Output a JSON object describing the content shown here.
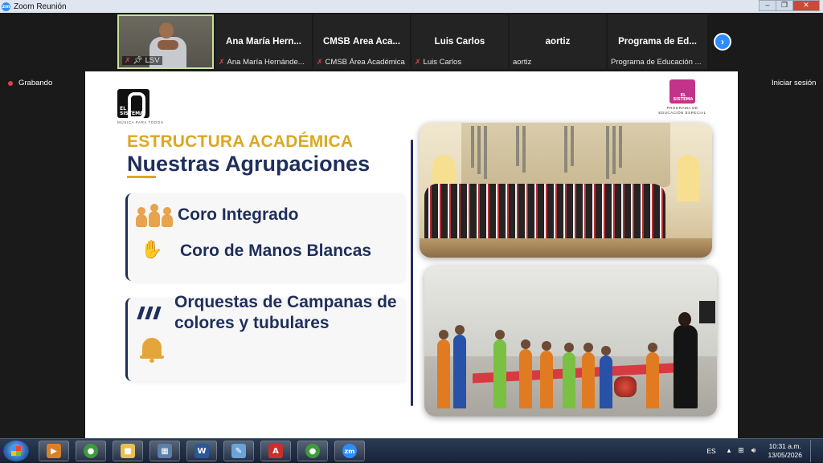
{
  "window": {
    "app_icon": "zm",
    "title": "Zoom Reunión",
    "controls": [
      "minimize",
      "restore",
      "close"
    ]
  },
  "gallery": {
    "tiles": [
      {
        "big_name": "",
        "label": "LSV",
        "video": true,
        "muted": true
      },
      {
        "big_name": "Ana María Hern...",
        "label": "Ana María Hernánde...",
        "video": false,
        "muted": true
      },
      {
        "big_name": "CMSB Área Aca...",
        "label": "CMSB Área Académica",
        "video": false,
        "muted": true
      },
      {
        "big_name": "Luis Carlos",
        "label": "Luis Carlos",
        "video": false,
        "muted": true
      },
      {
        "big_name": "aortiz",
        "label": "aortiz",
        "video": false,
        "muted": false
      },
      {
        "big_name": "Programa de Ed...",
        "label": "Programa de Educación ...",
        "video": false,
        "muted": false
      }
    ],
    "next_icon": "chevron-right-icon"
  },
  "status": {
    "recording_label": "Grabando",
    "signin_label": "Iniciar sesión"
  },
  "slide": {
    "logo_left_text": "EL SISTEMA",
    "logo_left_tag": "MÚSICA PARA TODOS",
    "logo_right_text": "EL SISTEMA",
    "logo_right_sub": "PROGRAMA DE EDUCACIÓN ESPECIAL",
    "kicker": "ESTRUCTURA ACADÉMICA",
    "heading_first": "Nu",
    "heading_rest": "estras Agrupaciones",
    "items": [
      {
        "icon": "choir-icon",
        "text": "Coro Integrado"
      },
      {
        "icon": "sign-language-icon",
        "text": "Coro de Manos Blancas"
      },
      {
        "icon": "handbells-icon",
        "text": "Orquestas de Campanas de colores y tubulares"
      },
      {
        "icon": "bell-icon",
        "text": ""
      }
    ],
    "accent_gold": "#dba81f",
    "accent_navy": "#1f2f5c"
  },
  "taskbar": {
    "apps": [
      {
        "name": "media-player",
        "glyph": "▶",
        "color": "#d8812b"
      },
      {
        "name": "chrome",
        "glyph": "●",
        "color": "#3f9a3f"
      },
      {
        "name": "file-explorer",
        "glyph": "■",
        "color": "#e8c04f"
      },
      {
        "name": "calculator",
        "glyph": "▦",
        "color": "#5d7ea8"
      },
      {
        "name": "word",
        "glyph": "W",
        "color": "#2b5797"
      },
      {
        "name": "paint",
        "glyph": "✎",
        "color": "#6aa3d9"
      },
      {
        "name": "acrobat",
        "glyph": "A",
        "color": "#c9302c"
      },
      {
        "name": "chrome-2",
        "glyph": "●",
        "color": "#3f9a3f"
      },
      {
        "name": "zoom",
        "glyph": "zm",
        "color": "#2d8cff"
      }
    ],
    "lang": "ES",
    "time": "10:31 a.m.",
    "date": "13/05/2026"
  }
}
